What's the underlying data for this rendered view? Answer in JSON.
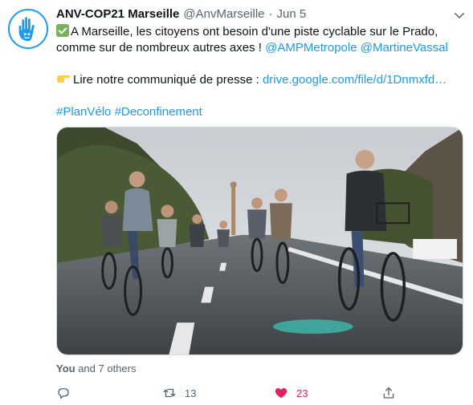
{
  "tweet": {
    "name": "ANV-COP21 Marseille",
    "handle": "@AnvMarseille",
    "separator": "·",
    "time": "Jun 5",
    "line1": "A Marseille, les citoyens ont besoin d'une piste cyclable sur le Prado,",
    "line2_text": "comme sur de nombreux autres axes ! ",
    "mention1": "@AMPMetropole",
    "mention2": "@MartineVassal",
    "press_label": "Lire notre communiqué de presse : ",
    "press_link": "drive.google.com/file/d/1Dnmxfd…",
    "hashtag1": "#PlanVélo",
    "hashtag2": "#Deconfinement",
    "likes_you": "You",
    "likes_rest": " and 7 others",
    "retweet_count": "13",
    "like_count": "23"
  },
  "icons": {
    "avatar": "hand-logo-icon",
    "caret": "chevron-down-icon",
    "reply": "reply-icon",
    "retweet": "retweet-icon",
    "like": "heart-icon",
    "share": "share-icon",
    "check": "check-mark-emoji",
    "pointing": "pointing-hand-emoji"
  },
  "colors": {
    "link": "#1d9bf0",
    "like_active": "#e0245e",
    "secondary": "#536471",
    "text": "#0f1419",
    "avatar_brand": "#1d9bf0"
  }
}
